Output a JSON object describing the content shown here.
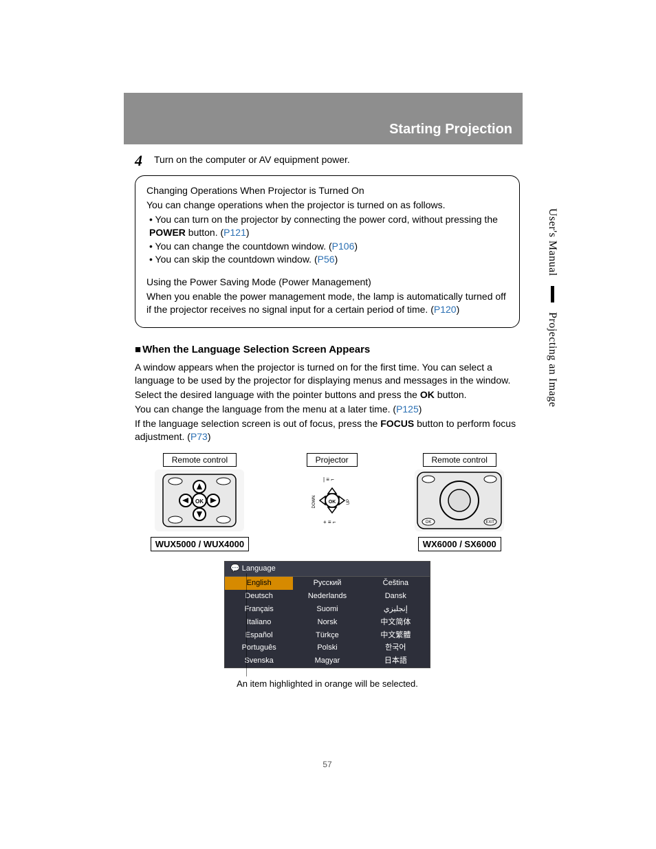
{
  "header": {
    "title": "Starting Projection"
  },
  "step": {
    "num": "4",
    "text": "Turn on the computer or AV equipment power."
  },
  "box": {
    "title1": "Changing Operations When Projector is Turned On",
    "intro1": "You can change operations when the projector is turned on as follows.",
    "b1a": "You can turn on the projector by connecting the power cord, without pressing the ",
    "b1a_bold": "POWER",
    "b1a_tail": " button. (",
    "b1a_link": "P121",
    "b1a_close": ")",
    "b2a": "You can change the countdown window. (",
    "b2a_link": "P106",
    "b2a_close": ")",
    "b3a": "You can skip the countdown window. (",
    "b3a_link": "P56",
    "b3a_close": ")",
    "title2": "Using the Power Saving Mode (Power Management)",
    "body2a": "When you enable the power management mode, the lamp is automatically turned off if the projector receives no signal input for a certain period of time. (",
    "body2_link": "P120",
    "body2_close": ")"
  },
  "section": {
    "heading": "When the Language Selection Screen Appears",
    "p1": "A window appears when the projector is turned on for the first time. You can select a language to be used by the projector for displaying menus and messages in the window.",
    "p2a": "Select the desired language with the pointer buttons and press the ",
    "p2_bold": "OK",
    "p2b": " button.",
    "p3a": "You can change the language from the menu at a later time. (",
    "p3_link": "P125",
    "p3_close": ")",
    "p4a": "If the language selection screen is out of focus, press the ",
    "p4_bold": "FOCUS",
    "p4b": " button to perform focus adjustment. (",
    "p4_link": "P73",
    "p4_close": ")"
  },
  "controls": {
    "remote_label": "Remote control",
    "projector_label": "Projector",
    "model_a": "WUX5000 / WUX4000",
    "model_b": "WX6000 / SX6000"
  },
  "lang_menu": {
    "header": "Language",
    "col1": [
      "English",
      "Deutsch",
      "Français",
      "Italiano",
      "Español",
      "Português",
      "Svenska"
    ],
    "col2": [
      "Русский",
      "Nederlands",
      "Suomi",
      "Norsk",
      "Türkçe",
      "Polski",
      "Magyar"
    ],
    "col3": [
      "Čeština",
      "Dansk",
      "إنجليزي",
      "中文简体",
      "中文繁體",
      "한국어",
      "日本語"
    ]
  },
  "caption": "An item highlighted in orange will be selected.",
  "pagenum": "57",
  "side": {
    "a": "User's Manual",
    "b": "Projecting an Image"
  }
}
